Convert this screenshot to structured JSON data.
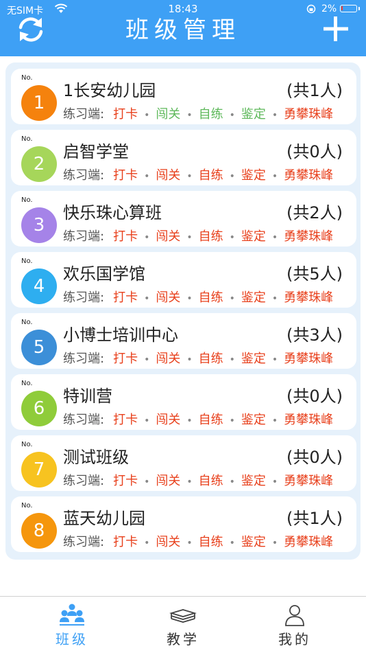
{
  "status_bar": {
    "carrier": "无SIM卡",
    "time": "18:43",
    "battery": "2%"
  },
  "header": {
    "title": "班级管理",
    "refresh_icon": "refresh-icon",
    "add_icon": "plus-icon",
    "background": "#3ea0f5"
  },
  "practice": {
    "label": "练习端:",
    "modes": [
      "打卡",
      "闯关",
      "自练",
      "鉴定",
      "勇攀珠峰"
    ]
  },
  "classes": [
    {
      "no_label": "No.",
      "number": "1",
      "name": "1长安幼儿园",
      "count": "(共1人)",
      "color": "#f5820d",
      "mode_colors": [
        "#e8401c",
        "#5db85a",
        "#5db85a",
        "#5db85a",
        "#e8401c"
      ]
    },
    {
      "no_label": "No.",
      "number": "2",
      "name": "启智学堂",
      "count": "(共0人)",
      "color": "#a6d65a",
      "mode_colors": [
        "#e8401c",
        "#e8401c",
        "#e8401c",
        "#e8401c",
        "#e8401c"
      ]
    },
    {
      "no_label": "No.",
      "number": "3",
      "name": "快乐珠心算班",
      "count": "(共2人)",
      "color": "#a583e8",
      "mode_colors": [
        "#e8401c",
        "#e8401c",
        "#e8401c",
        "#e8401c",
        "#e8401c"
      ]
    },
    {
      "no_label": "No.",
      "number": "4",
      "name": "欢乐国学馆",
      "count": "(共5人)",
      "color": "#2eaef0",
      "mode_colors": [
        "#e8401c",
        "#e8401c",
        "#e8401c",
        "#e8401c",
        "#e8401c"
      ]
    },
    {
      "no_label": "No.",
      "number": "5",
      "name": "小博士培训中心",
      "count": "(共3人)",
      "color": "#3c8fd8",
      "mode_colors": [
        "#e8401c",
        "#e8401c",
        "#e8401c",
        "#e8401c",
        "#e8401c"
      ]
    },
    {
      "no_label": "No.",
      "number": "6",
      "name": "特训营",
      "count": "(共0人)",
      "color": "#8fcc3a",
      "mode_colors": [
        "#e8401c",
        "#e8401c",
        "#e8401c",
        "#e8401c",
        "#e8401c"
      ]
    },
    {
      "no_label": "No.",
      "number": "7",
      "name": "测试班级",
      "count": "(共0人)",
      "color": "#f7c320",
      "mode_colors": [
        "#e8401c",
        "#e8401c",
        "#e8401c",
        "#e8401c",
        "#e8401c"
      ]
    },
    {
      "no_label": "No.",
      "number": "8",
      "name": "蓝天幼儿园",
      "count": "(共1人)",
      "color": "#f5960d",
      "mode_colors": [
        "#e8401c",
        "#e8401c",
        "#e8401c",
        "#e8401c",
        "#e8401c"
      ]
    }
  ],
  "tabbar": {
    "items": [
      {
        "label": "班级",
        "icon": "class-group-icon",
        "active": true,
        "color": "#3ea0f5"
      },
      {
        "label": "教学",
        "icon": "books-icon",
        "active": false,
        "color": "#333333"
      },
      {
        "label": "我的",
        "icon": "user-icon",
        "active": false,
        "color": "#333333"
      }
    ]
  }
}
